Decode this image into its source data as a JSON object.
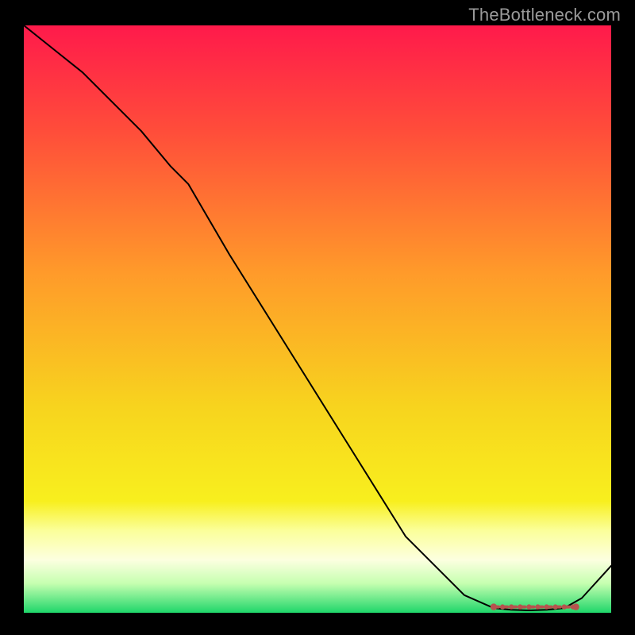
{
  "watermark": "TheBottleneck.com",
  "chart_data": {
    "type": "line",
    "title": "",
    "xlabel": "",
    "ylabel": "",
    "xlim": [
      0,
      100
    ],
    "ylim": [
      0,
      100
    ],
    "axes_visible": false,
    "background_gradient": {
      "top": "#ff1a4b",
      "mid_upper": "#ff9a2a",
      "mid_lower": "#f8ef1e",
      "band_pale": "#fbff9a",
      "bottom": "#1fd66a"
    },
    "series": [
      {
        "name": "curve",
        "stroke": "#000000",
        "stroke_width": 2,
        "x": [
          0,
          5,
          10,
          15,
          20,
          25,
          28,
          35,
          45,
          55,
          65,
          75,
          80,
          83,
          86,
          89,
          92,
          95,
          100
        ],
        "y": [
          100,
          96,
          92,
          87,
          82,
          76,
          73,
          61,
          45,
          29,
          13,
          3,
          0.8,
          0.5,
          0.4,
          0.5,
          0.8,
          2.5,
          8
        ]
      }
    ],
    "marker_band": {
      "name": "optimal-region",
      "color": "#b6534e",
      "y": 1.0,
      "x_start": 80,
      "x_end": 94,
      "points_x": [
        80,
        81.5,
        83,
        84.5,
        86,
        87.5,
        89,
        90.5,
        92,
        93.5,
        94
      ],
      "dash_between": true
    }
  }
}
